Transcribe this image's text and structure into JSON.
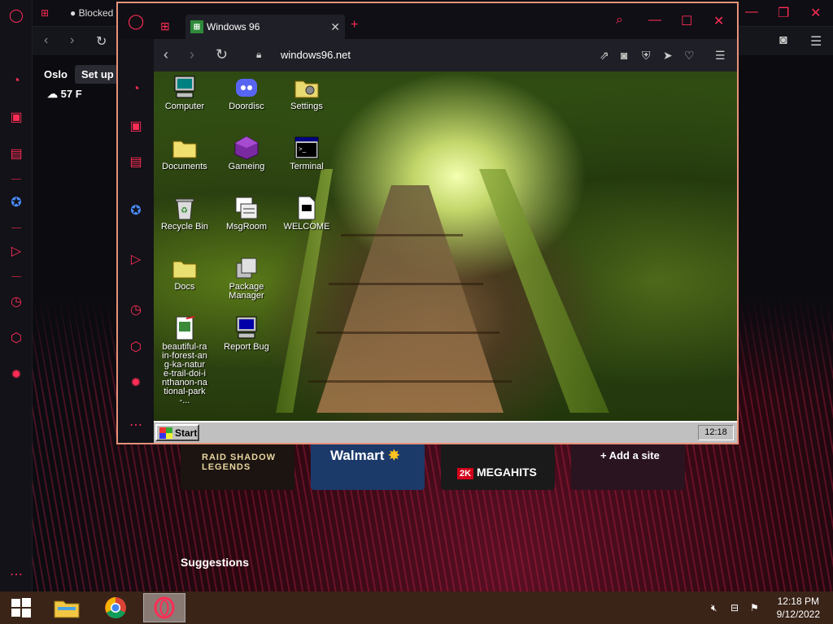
{
  "background_browser": {
    "tab_title": "Blocked",
    "weather": {
      "city": "Oslo",
      "temperature": "57 F",
      "setup_label": "Set up"
    },
    "tiles": [
      {
        "label": "RAID SHADOW LEGENDS"
      },
      {
        "label": "Walmart"
      },
      {
        "label": "MEGAHITS"
      },
      {
        "label": "+ Add a site"
      }
    ],
    "suggestions_label": "Suggestions"
  },
  "popup_browser": {
    "tab_title": "Windows 96",
    "url": "windows96.net"
  },
  "desktop_icons": [
    {
      "label": "Computer",
      "icon": "computer-icon"
    },
    {
      "label": "Doordisc",
      "icon": "discord-icon"
    },
    {
      "label": "Settings",
      "icon": "settings-icon"
    },
    {
      "label": "Documents",
      "icon": "folder-icon"
    },
    {
      "label": "Gameing",
      "icon": "game-icon"
    },
    {
      "label": "Terminal",
      "icon": "terminal-icon"
    },
    {
      "label": "Recycle Bin",
      "icon": "recycle-bin-icon"
    },
    {
      "label": "MsgRoom",
      "icon": "msgroom-icon"
    },
    {
      "label": "WELCOME",
      "icon": "document-icon"
    },
    {
      "label": "Docs",
      "icon": "folder-icon"
    },
    {
      "label": "Package Manager",
      "icon": "package-icon"
    },
    {
      "label": "beautiful-rain-forest-ang-ka-nature-trail-doi-inthanon-national-park-...",
      "icon": "image-file-icon"
    },
    {
      "label": "Report Bug",
      "icon": "report-bug-icon"
    }
  ],
  "win96_taskbar": {
    "start_label": "Start",
    "clock": "12:18"
  },
  "system_taskbar": {
    "time": "12:18 PM",
    "date": "9/12/2022"
  }
}
